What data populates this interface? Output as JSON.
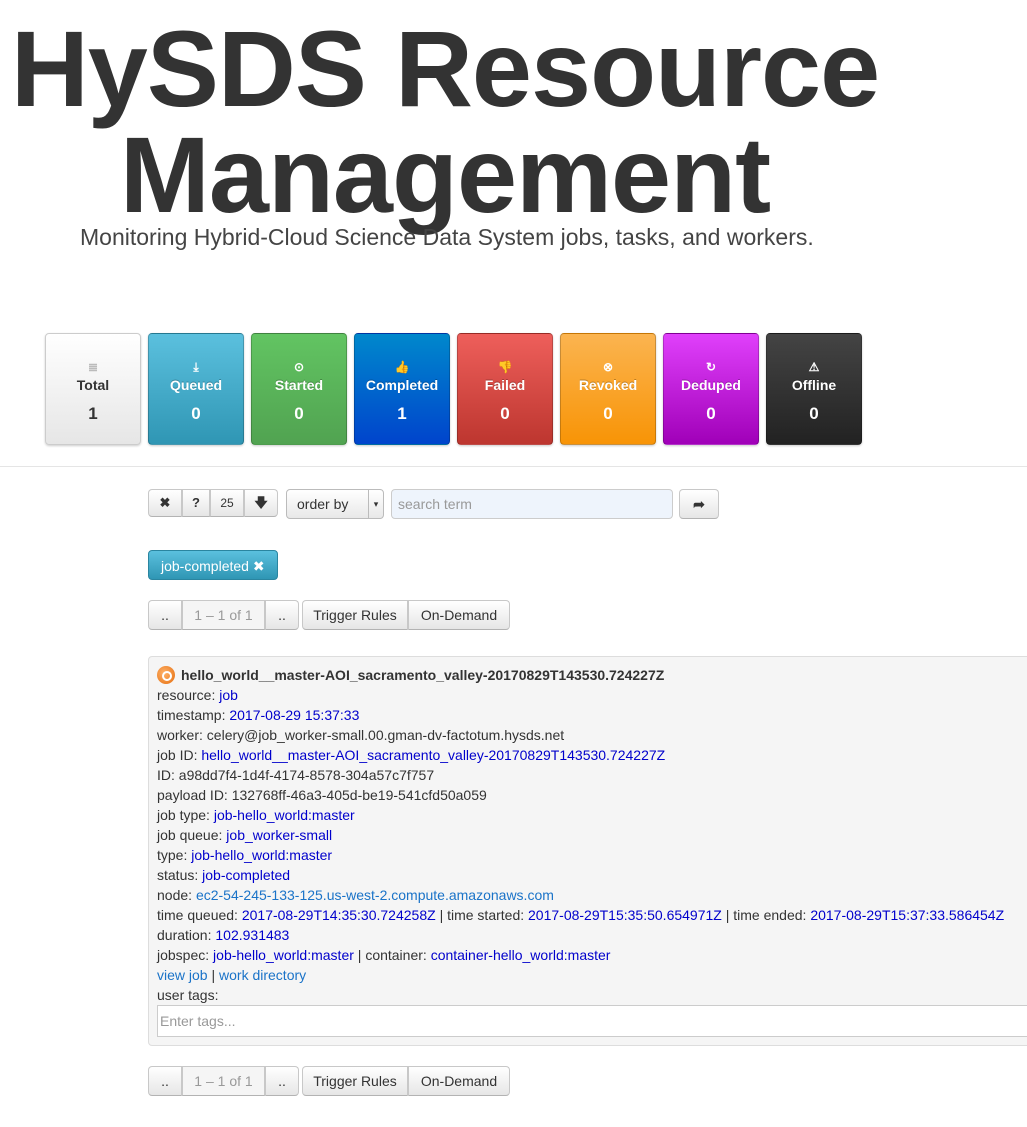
{
  "header": {
    "title_line1": "HySDS Resource",
    "title_line2": "Management",
    "subtitle": "Monitoring Hybrid-Cloud Science Data System jobs, tasks, and workers."
  },
  "stats": [
    {
      "label": "Total",
      "count": "1",
      "icon": "list-icon",
      "glyph": "≣",
      "color": "#e6e6e6"
    },
    {
      "label": "Queued",
      "count": "0",
      "icon": "download-icon",
      "glyph": "⤓",
      "color": "#2f96b4"
    },
    {
      "label": "Started",
      "count": "0",
      "icon": "play-circle-icon",
      "glyph": "⊙",
      "color": "#51a351"
    },
    {
      "label": "Completed",
      "count": "1",
      "icon": "thumbs-up-icon",
      "glyph": "👍",
      "color": "#0044cc"
    },
    {
      "label": "Failed",
      "count": "0",
      "icon": "thumbs-down-icon",
      "glyph": "👎",
      "color": "#bd362f"
    },
    {
      "label": "Revoked",
      "count": "0",
      "icon": "cancel-circle-icon",
      "glyph": "⊗",
      "color": "#f89406"
    },
    {
      "label": "Deduped",
      "count": "0",
      "icon": "refresh-icon",
      "glyph": "↻",
      "color": "#a000b8"
    },
    {
      "label": "Offline",
      "count": "0",
      "icon": "warning-icon",
      "glyph": "⚠",
      "color": "#222222"
    }
  ],
  "toolbar": {
    "clear_glyph": "✖",
    "help_label": "?",
    "page_size": "25",
    "download_glyph": "🡇",
    "order_by": "order by",
    "search_placeholder": "search term",
    "go_glyph": "➦"
  },
  "filter_tag": {
    "label": "job-completed ✖"
  },
  "pager": {
    "first": "..",
    "range": "1 – 1 of 1",
    "last": "..",
    "trigger_rules": "Trigger Rules",
    "on_demand": "On-Demand"
  },
  "result": {
    "title": "hello_world__master-AOI_sacramento_valley-20170829T143530.724227Z",
    "resource_label": "resource:",
    "resource": "job",
    "timestamp_label": "timestamp:",
    "timestamp": "2017-08-29 15:37:33",
    "worker_label": "worker:",
    "worker": "celery@job_worker-small.00.gman-dv-factotum.hysds.net",
    "job_id_label": "job ID:",
    "job_id": "hello_world__master-AOI_sacramento_valley-20170829T143530.724227Z",
    "id_label": "ID:",
    "id": "a98dd7f4-1d4f-4174-8578-304a57c7f757",
    "payload_label": "payload ID:",
    "payload_id": "132768ff-46a3-405d-be19-541cfd50a059",
    "job_type_label": "job type:",
    "job_type": "job-hello_world:master",
    "job_queue_label": "job queue:",
    "job_queue": "job_worker-small",
    "type_label": "type:",
    "type": "job-hello_world:master",
    "status_label": "status:",
    "status": "job-completed",
    "node_label": "node:",
    "node": "ec2-54-245-133-125.us-west-2.compute.amazonaws.com",
    "time_queued_label": "time queued:",
    "time_queued": "2017-08-29T14:35:30.724258Z",
    "sep": "|",
    "time_started_label": "time started:",
    "time_started": "2017-08-29T15:35:50.654971Z",
    "time_ended_label": "time ended:",
    "time_ended": "2017-08-29T15:37:33.586454Z",
    "duration_label": "duration:",
    "duration": "102.931483",
    "jobspec_label": "jobspec:",
    "jobspec": "job-hello_world:master",
    "container_label": "container:",
    "container": "container-hello_world:master",
    "view_job": "view job",
    "work_directory": "work directory",
    "user_tags_label": "user tags:",
    "tags_placeholder": "Enter tags..."
  }
}
